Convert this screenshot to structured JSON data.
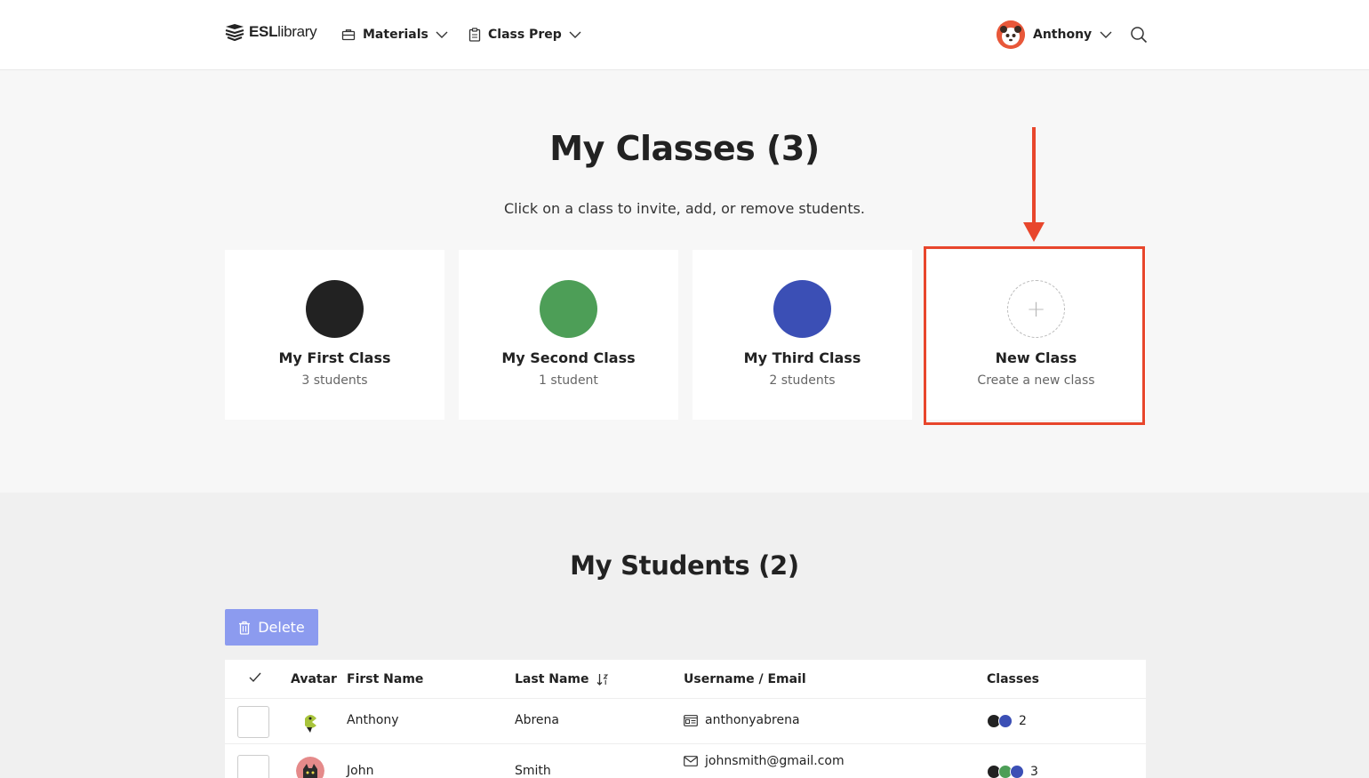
{
  "header": {
    "logo_bold": "ESL",
    "logo_rest": "library",
    "nav": [
      {
        "label": "Materials",
        "icon": "briefcase-icon"
      },
      {
        "label": "Class Prep",
        "icon": "clipboard-icon"
      }
    ],
    "user_name": "Anthony"
  },
  "classes": {
    "title": "My Classes (3)",
    "subtitle": "Click on a class to invite, add, or remove students.",
    "cards": [
      {
        "name": "My First Class",
        "count": "3 students",
        "color": "#222222"
      },
      {
        "name": "My Second Class",
        "count": "1 student",
        "color": "#4d9e57"
      },
      {
        "name": "My Third Class",
        "count": "2 students",
        "color": "#3b4fb5"
      }
    ],
    "new_card": {
      "name": "New Class",
      "count": "Create a new class",
      "plus": "+"
    },
    "highlight_color": "#e8462c"
  },
  "students": {
    "title": "My Students (2)",
    "delete_label": "Delete",
    "columns": {
      "avatar": "Avatar",
      "first": "First Name",
      "last": "Last Name",
      "username": "Username / Email",
      "classes": "Classes"
    },
    "rows": [
      {
        "first": "Anthony",
        "last": "Abrena",
        "login": "anthonyabrena",
        "login_icon": "id-card-icon",
        "class_colors": [
          "#222222",
          "#3b4fb5"
        ],
        "class_count": "2"
      },
      {
        "first": "John",
        "last": "Smith",
        "login": "johnsmith@gmail.com",
        "login_icon": "mail-icon",
        "class_colors": [
          "#222222",
          "#4d9e57",
          "#3b4fb5"
        ],
        "class_count": "3"
      }
    ]
  }
}
